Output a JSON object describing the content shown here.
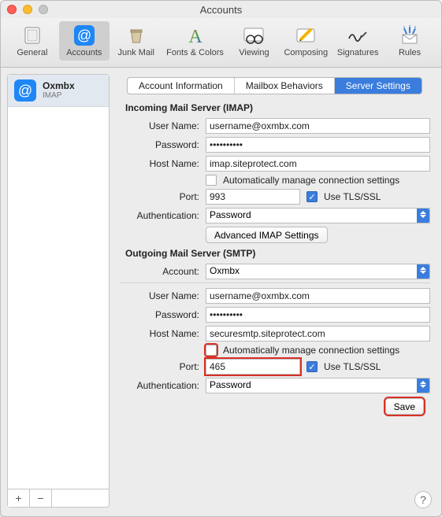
{
  "window": {
    "title": "Accounts"
  },
  "toolbar": {
    "items": [
      {
        "label": "General"
      },
      {
        "label": "Accounts"
      },
      {
        "label": "Junk Mail"
      },
      {
        "label": "Fonts & Colors"
      },
      {
        "label": "Viewing"
      },
      {
        "label": "Composing"
      },
      {
        "label": "Signatures"
      },
      {
        "label": "Rules"
      }
    ]
  },
  "sidebar": {
    "account": {
      "name": "Oxmbx",
      "type": "IMAP"
    },
    "add": "+",
    "remove": "−"
  },
  "tabs": {
    "info": "Account Information",
    "mailbox": "Mailbox Behaviors",
    "server": "Server Settings"
  },
  "incoming": {
    "heading": "Incoming Mail Server (IMAP)",
    "username_label": "User Name:",
    "username": "username@oxmbx.com",
    "password_label": "Password:",
    "password": "••••••••••",
    "hostname_label": "Host Name:",
    "hostname": "imap.siteprotect.com",
    "auto_label": "Automatically manage connection settings",
    "port_label": "Port:",
    "port": "993",
    "tls_label": "Use TLS/SSL",
    "auth_label": "Authentication:",
    "auth_value": "Password",
    "adv_btn": "Advanced IMAP Settings"
  },
  "outgoing": {
    "heading": "Outgoing Mail Server (SMTP)",
    "account_label": "Account:",
    "account_value": "Oxmbx",
    "username_label": "User Name:",
    "username": "username@oxmbx.com",
    "password_label": "Password:",
    "password": "••••••••••",
    "hostname_label": "Host Name:",
    "hostname": "securesmtp.siteprotect.com",
    "auto_label": "Automatically manage connection settings",
    "port_label": "Port:",
    "port": "465",
    "tls_label": "Use TLS/SSL",
    "auth_label": "Authentication:",
    "auth_value": "Password"
  },
  "save_btn": "Save",
  "help": "?"
}
